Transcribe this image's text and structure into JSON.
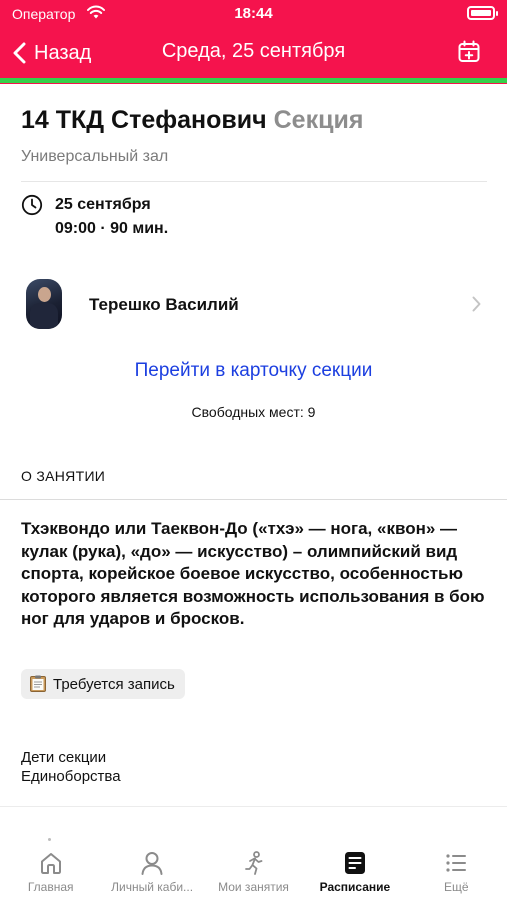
{
  "status_bar": {
    "carrier": "Оператор",
    "time": "18:44"
  },
  "nav": {
    "back_label": "Назад",
    "title": "Среда, 25 сентября"
  },
  "event": {
    "title_main": "14 ТКД Стефанович",
    "title_kind": "Секция",
    "hall": "Универсальный зал",
    "date": "25 сентября",
    "time": "09:00 · 90 мин.",
    "trainer_name": "Терешко Василий",
    "section_link": "Перейти в карточку секции",
    "free_places": "Свободных мест: 9"
  },
  "about": {
    "header": "О ЗАНЯТИИ",
    "description": "Тхэквондо или Таеквон-До («тхэ» — нога, «квон» — кулак (рука), «до» — искусство) – олимпийский вид спорта, корейское боевое искусство, особенностью которого является возможность использования в бою ног для ударов и бросков.",
    "badge_label": "Требуется запись",
    "tags": [
      "Дети секции",
      "Единоборства"
    ]
  },
  "tab_bar": {
    "items": [
      {
        "label": "Главная",
        "icon": "home-icon",
        "active": false
      },
      {
        "label": "Личный каби...",
        "icon": "person-icon",
        "active": false
      },
      {
        "label": "Мои занятия",
        "icon": "runner-icon",
        "active": false
      },
      {
        "label": "Расписание",
        "icon": "schedule-icon",
        "active": true
      },
      {
        "label": "Ещё",
        "icon": "list-icon",
        "active": false
      }
    ]
  },
  "colors": {
    "header": "#f5134d",
    "header_accent_line": "#35d04a",
    "link": "#1c3fe0",
    "muted_text": "#8d8d8d",
    "tab_inactive": "#8b8b8b"
  }
}
